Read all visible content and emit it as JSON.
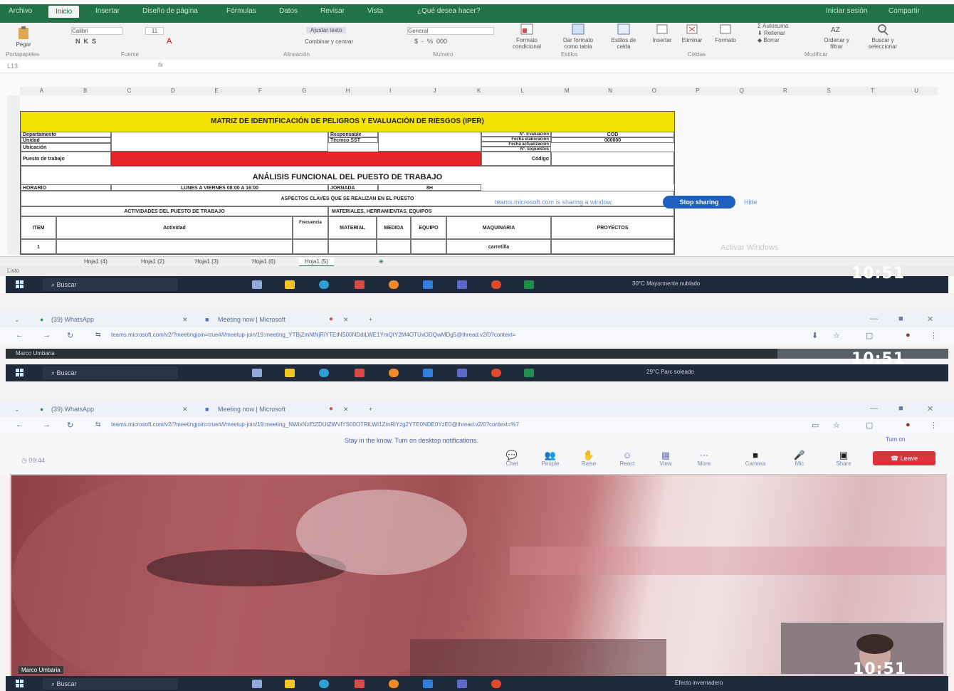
{
  "excel": {
    "tabs": [
      "Archivo",
      "Inicio",
      "Insertar",
      "Diseño de página",
      "Fórmulas",
      "Datos",
      "Revisar",
      "Vista",
      "¿Qué desea hacer?"
    ],
    "right_tabs": [
      "Iniciar sesión",
      "Compartir"
    ],
    "ribbon": {
      "paste_label": "Pegar",
      "font_name": "Calibri",
      "font_size": "11",
      "wrap_label": "Ajustar texto",
      "merge_label": "Combinar y centrar",
      "number_format": "General",
      "cond_format": "Formato condicional",
      "format_table": "Dar formato como tabla",
      "cell_styles": "Estilos de celda",
      "insert": "Insertar",
      "delete": "Eliminar",
      "format": "Formato",
      "autosum": "Autosuma",
      "fill": "Rellenar",
      "clear": "Borrar",
      "sort_filter": "Ordenar y filtrar",
      "find_select": "Buscar y seleccionar",
      "groups": [
        "Portapapeles",
        "Fuente",
        "Alineación",
        "Número",
        "Estilos",
        "Celdas",
        "Modificar"
      ]
    },
    "name_box": "L13",
    "col_headers": [
      "A",
      "B",
      "C",
      "D",
      "E",
      "F",
      "G",
      "H",
      "I",
      "J",
      "K",
      "L",
      "M",
      "N",
      "O",
      "P",
      "Q",
      "R",
      "S",
      "T",
      "U"
    ],
    "sheet": {
      "title": "MATRIZ DE IDENTIFICACIÓN DE PELIGROS Y EVALUACIÓN DE RIESGOS (IPER)",
      "left_labels": [
        "Departamento",
        "Unidad",
        "Ubicación"
      ],
      "puesto": "Puesto de trabajo",
      "mid_labels": [
        "Responsable",
        "Técnico SST"
      ],
      "right_labels": [
        "Nº. Evaluación",
        "Fecha elaboración",
        "Fecha actualización",
        "Nº. Expuestos"
      ],
      "right_values": [
        "COD",
        "000000"
      ],
      "codigo": "Código",
      "analisis": "ANÁLISIS FUNCIONAL DEL PUESTO DE TRABAJO",
      "horario_label": "HORARIO",
      "horario_value": "LUNES A VIERNES 08:00 A 16:00",
      "turno_label": "JORNADA",
      "turno_value": "8H",
      "aspectos": "ASPECTOS CLAVES QUE SE REALIZAN EN EL PUESTO",
      "actividades": "ACTIVIDADES DEL PUESTO DE TRABAJO",
      "materiales": "MATERIALES, HERRAMIENTAS, EQUIPOS",
      "headers": [
        "ITEM",
        "Actividad",
        "Frecuencia",
        "MATERIAL",
        "MEDIDA",
        "EQUIPO",
        "MAQUINARIA",
        "PROYECTOS"
      ],
      "row1": [
        "1",
        "",
        "",
        "",
        "",
        "",
        "carretilla",
        ""
      ]
    },
    "sheet_tabs": [
      "Hoja1 (4)",
      "Hoja1 (2)",
      "Hoja1 (3)",
      "Hoja1 (6)",
      "Hoja1 (5)"
    ],
    "active_tab": 4,
    "status": "Listo",
    "share_text": "teams.microsoft.com is sharing a window.",
    "stop_sharing": "Stop sharing",
    "hide": "Hide",
    "activate_windows": "Activar Windows"
  },
  "taskbars": [
    {
      "search": "Buscar",
      "weather": "30°C  Mayormente nublado",
      "clock": "10:51"
    },
    {
      "search": "Buscar",
      "weather": "29°C  Parc soleado",
      "clock": "10:51"
    },
    {
      "search": "Buscar",
      "weather": "Efecto invernadero",
      "clock": "10:51"
    }
  ],
  "browser1": {
    "tab1": "(39) WhatsApp",
    "tab2": "Meeting now | Microsoft",
    "url": "teams.microsoft.com/v2/?meetingjoin=true#/l/meetup-join/19:meeting_YTBjZmNlNjRiYTEtNS00NDdiLWE1YmQtY2M4OTUxODQwMDg5@thread.v2/0?context=",
    "presenter": "Marco Umbaria"
  },
  "browser2": {
    "tab1": "(39) WhatsApp",
    "tab2": "Meeting now | Microsoft",
    "url": "teams.microsoft.com/v2/?meetingjoin=true#/l/meetup-join/19:meeting_NWIxNzEtZDUtZWVlYS00OTRlLWI1ZmRiYzg2YTE0NDE0YzE0@thread.v2/0?context=%7",
    "notif": "Stay in the know. Turn on desktop notifications.",
    "notif_action": "Turn on"
  },
  "teams": {
    "timer": "09:44",
    "buttons": [
      "Chat",
      "People",
      "Raise",
      "React",
      "View",
      "More",
      "Camera",
      "Mic",
      "Share"
    ],
    "leave": "Leave",
    "participant_name": "Marco Umbaria"
  },
  "colors": {
    "excel_green": "#217346",
    "title_yellow": "#f5e400",
    "red_block": "#e8262a",
    "stop_blue": "#1f5fbf",
    "leave_red": "#d9343b",
    "taskbar": "#1f2a3a"
  }
}
